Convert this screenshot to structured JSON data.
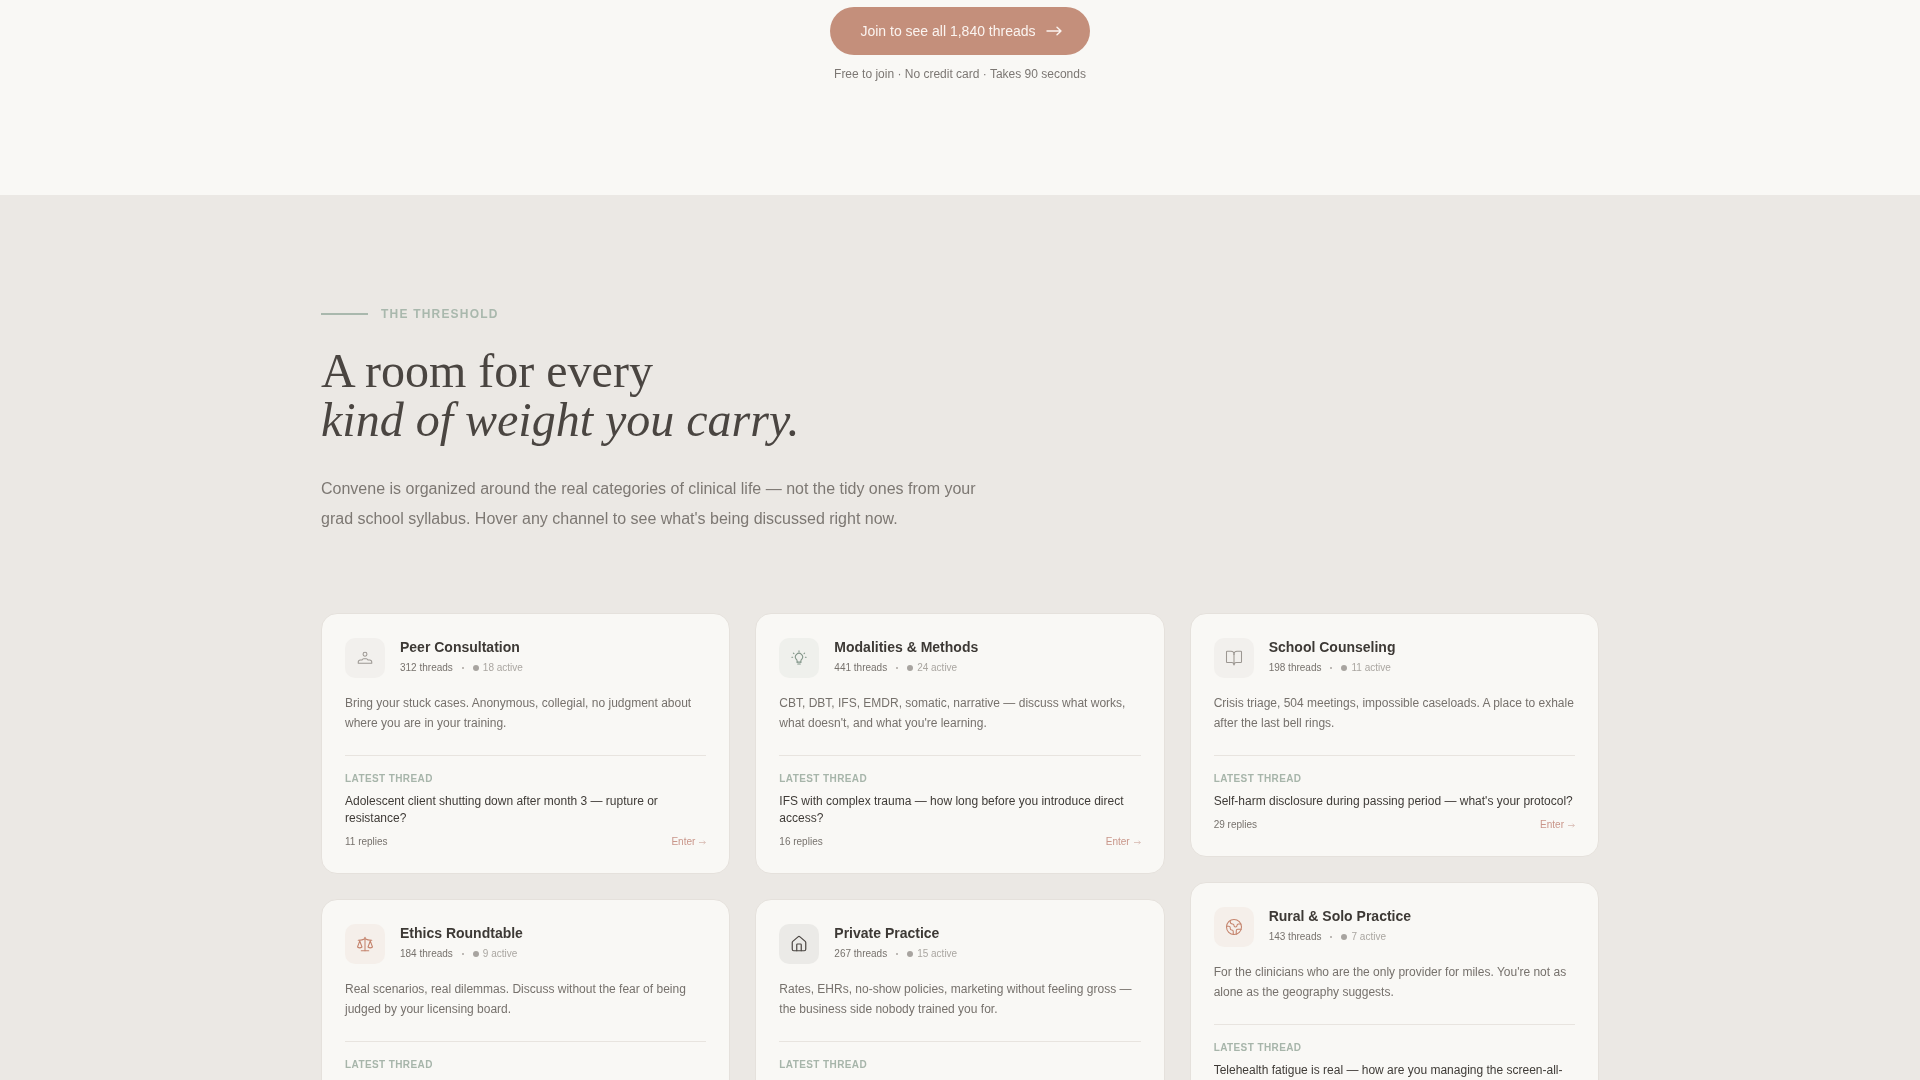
{
  "cta": {
    "button": "Join to see all 1,840 threads",
    "note": "Free to join · No credit card · Takes 90 seconds"
  },
  "section": {
    "eyebrow": "THE THRESHOLD",
    "heading_lines": [
      "A room for every",
      "kind of weight you carry."
    ],
    "description": "Convene is organized around the real categories of clinical life — not the tidy ones from your grad school syllabus. Hover any channel to see what's being discussed right now."
  },
  "channels": [
    {
      "name": "Peer Consultation",
      "threads": "312 threads",
      "active": "18 active",
      "description": "Bring your stuck cases. Anonymous, collegial, no judgment about where you are in your training.",
      "latest_label": "LATEST THREAD",
      "latest_title": "Adolescent client shutting down after month 3 — rupture or resistance?",
      "replies": "11 replies",
      "action": "Enter"
    },
    {
      "name": "Modalities & Methods",
      "threads": "441 threads",
      "active": "24 active",
      "description": "CBT, DBT, IFS, EMDR, somatic, narrative — discuss what works, what doesn't, and what you're learning.",
      "latest_label": "LATEST THREAD",
      "latest_title": "IFS with complex trauma — how long before you introduce direct access?",
      "replies": "16 replies",
      "action": "Enter"
    },
    {
      "name": "School Counseling",
      "threads": "198 threads",
      "active": "11 active",
      "description": "Crisis triage, 504 meetings, impossible caseloads. A place to exhale after the last bell rings.",
      "latest_label": "LATEST THREAD",
      "latest_title": "Self-harm disclosure during passing period — what's your protocol?",
      "replies": "29 replies",
      "action": "Enter"
    },
    {
      "name": "Ethics Roundtable",
      "threads": "184 threads",
      "active": "9 active",
      "description": "Real scenarios, real dilemmas. Discuss without the fear of being judged by your licensing board.",
      "latest_label": "LATEST THREAD"
    },
    {
      "name": "Private Practice",
      "threads": "267 threads",
      "active": "15 active",
      "description": "Rates, EHRs, no-show policies, marketing without feeling gross — the business side nobody trained you for.",
      "latest_label": "LATEST THREAD"
    },
    {
      "name": "Rural & Solo Practice",
      "threads": "143 threads",
      "active": "7 active",
      "description": "For the clinicians who are the only provider for miles. You're not as alone as the geography suggests.",
      "latest_label": "LATEST THREAD",
      "latest_title": "Telehealth fatigue is real — how are you managing the screen-all-"
    }
  ]
}
